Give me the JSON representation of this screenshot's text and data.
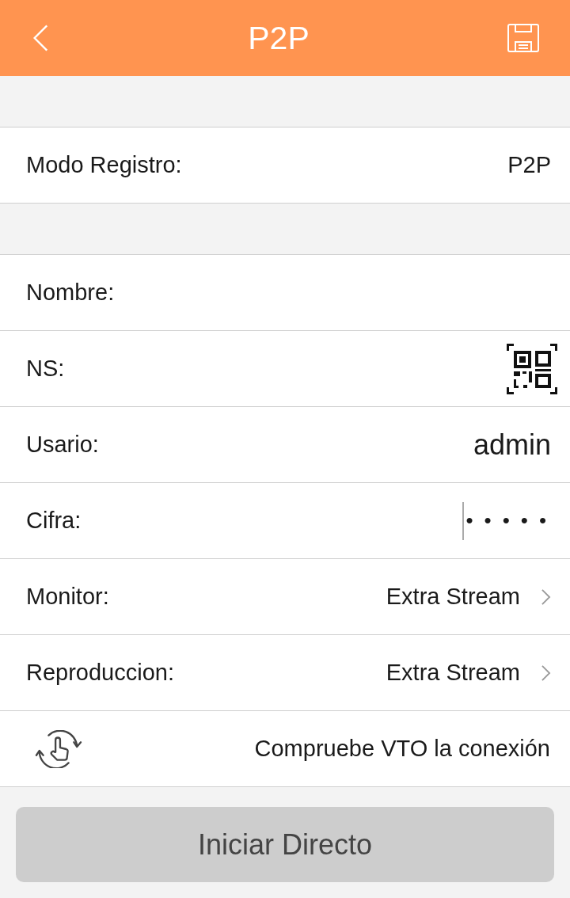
{
  "header": {
    "title": "P2P"
  },
  "sections": [
    {
      "rows": [
        {
          "kind": "value",
          "label": "Modo Registro:",
          "value": "P2P"
        }
      ]
    },
    {
      "rows": [
        {
          "kind": "input",
          "label": "Nombre:"
        },
        {
          "kind": "scan",
          "label": "NS:"
        },
        {
          "kind": "input",
          "label": "Usario:",
          "value": "admin"
        },
        {
          "kind": "password",
          "label": "Cifra:",
          "value": "•••••",
          "focused": true
        },
        {
          "kind": "select",
          "label": "Monitor:",
          "value": "Extra Stream"
        },
        {
          "kind": "select",
          "label": "Reproduccion:",
          "value": "Extra Stream"
        },
        {
          "kind": "action",
          "label": "Compruebe VTO la conexión"
        }
      ]
    }
  ],
  "button": {
    "label": "Iniciar Directo",
    "disabled": true
  }
}
